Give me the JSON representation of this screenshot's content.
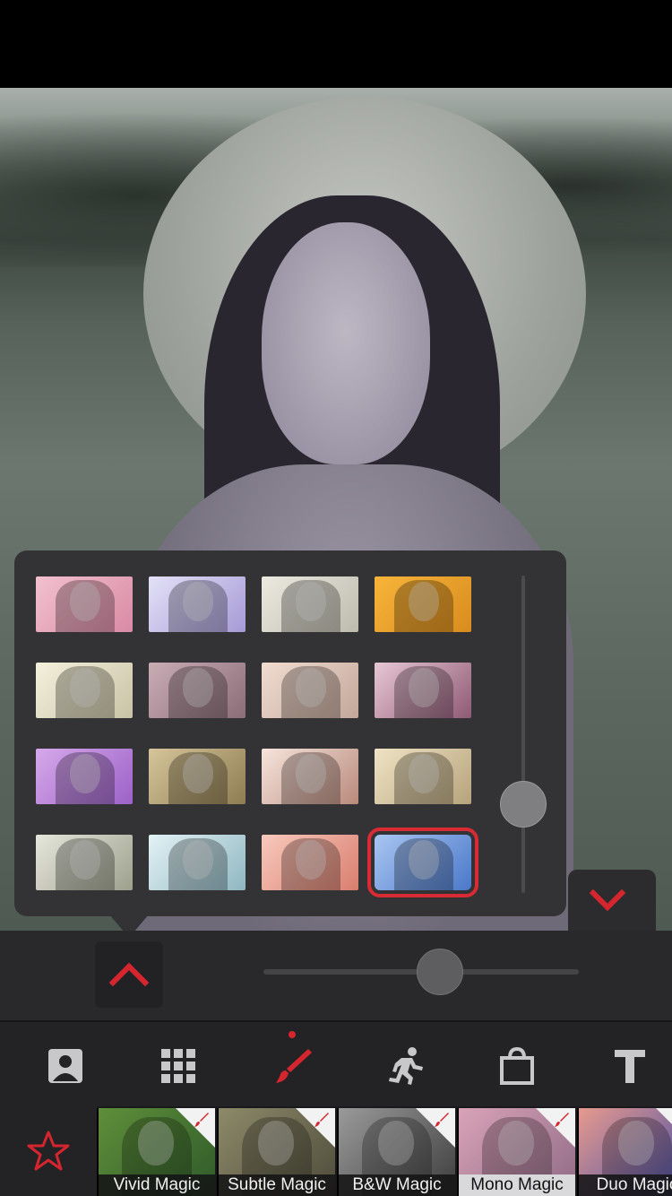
{
  "popup": {
    "thumbnails": [
      {
        "tint": "linear-gradient(135deg,#f2c1cf,#d98aa4)"
      },
      {
        "tint": "linear-gradient(135deg,#e3e1f7,#a69ad6)"
      },
      {
        "tint": "linear-gradient(135deg,#eceae0,#bdbbad)"
      },
      {
        "tint": "linear-gradient(135deg,#f7b43a,#d98c1e)"
      },
      {
        "tint": "linear-gradient(135deg,#f4f0dc,#c9c3a6)"
      },
      {
        "tint": "linear-gradient(135deg,#c9adb5,#8b6d78)"
      },
      {
        "tint": "linear-gradient(135deg,#f1dcd0,#c2a79a)"
      },
      {
        "tint": "linear-gradient(135deg,#e7c7d4,#8f5a75)"
      },
      {
        "tint": "linear-gradient(135deg,#d6a8ea,#9c62c8)"
      },
      {
        "tint": "linear-gradient(135deg,#d6c59a,#8e7c52)"
      },
      {
        "tint": "linear-gradient(135deg,#f6e4dc,#b98a7c)"
      },
      {
        "tint": "linear-gradient(135deg,#efe3c4,#b6a37c)"
      },
      {
        "tint": "linear-gradient(135deg,#e6e7dc,#9ea08e)"
      },
      {
        "tint": "linear-gradient(135deg,#e3f2f5,#8fb7c2)"
      },
      {
        "tint": "linear-gradient(135deg,#f8c9bd,#d97e6e)"
      },
      {
        "tint": "linear-gradient(135deg,#a9c6f2,#4b78c9)"
      }
    ],
    "selected_index": 15,
    "intensity_slider_fraction": 0.72
  },
  "controls": {
    "strength_slider_fraction": 0.56
  },
  "toolbar": {
    "tools": [
      {
        "name": "portrait-icon",
        "active": false
      },
      {
        "name": "grid-icon",
        "active": false
      },
      {
        "name": "brush-icon",
        "active": true
      },
      {
        "name": "running-figure-icon",
        "active": false
      },
      {
        "name": "bag-icon",
        "active": false
      },
      {
        "name": "text-icon",
        "active": false
      }
    ]
  },
  "presets": [
    {
      "label": "Vivid Magic",
      "tint": "linear-gradient(135deg,#5f8f3a,#2f5a2a)"
    },
    {
      "label": "Subtle Magic",
      "tint": "linear-gradient(135deg,#8d8a6a,#4e4b3a)"
    },
    {
      "label": "B&W Magic",
      "tint": "linear-gradient(135deg,#9a9a9a,#3d3d3d)"
    },
    {
      "label": "Mono Magic",
      "tint": "linear-gradient(135deg,#d9a3b8,#8f6a85)"
    },
    {
      "label": "Duo Magic",
      "tint": "linear-gradient(135deg,#e79a8e,#3c4aa8)"
    }
  ],
  "active_preset_index": 3,
  "colors": {
    "accent": "#d5262f",
    "icon": "#c8c8ca"
  }
}
